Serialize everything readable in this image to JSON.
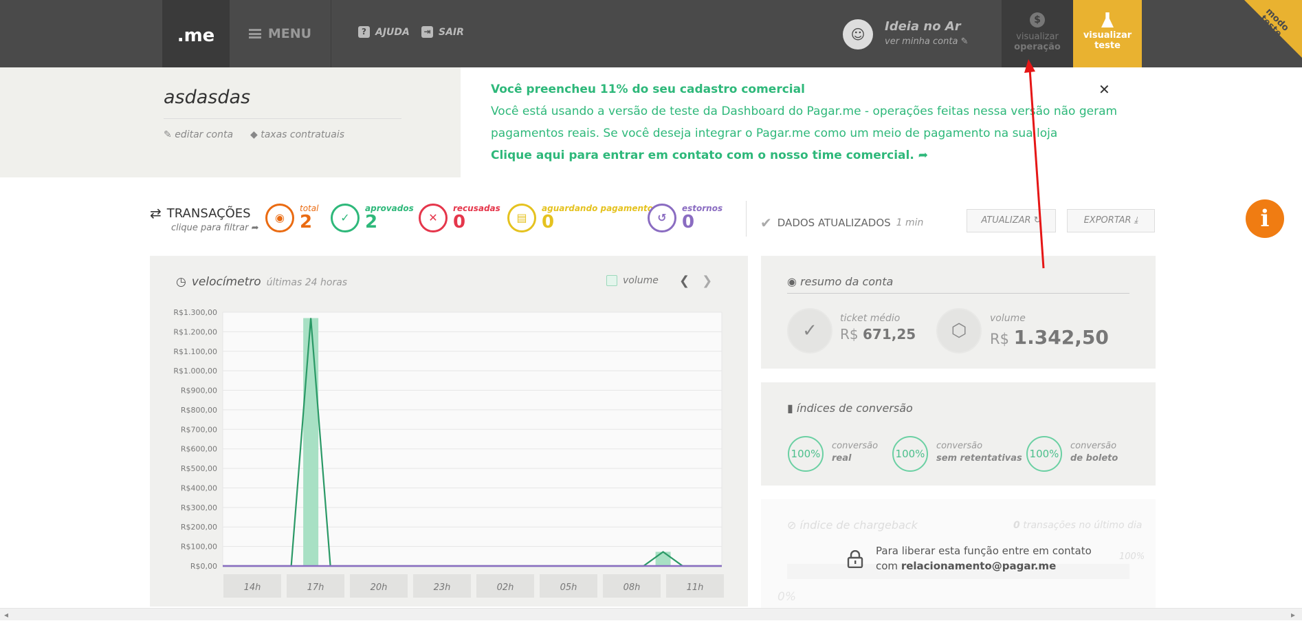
{
  "topbar": {
    "logo": ".me",
    "menu_label": "MENU",
    "help_label": "AJUDA",
    "exit_label": "SAIR",
    "user_name": "Ideia no Ar",
    "user_sub": "ver minha conta",
    "view_operation_line1": "visualizar",
    "view_operation_line2": "operação",
    "view_test_line1": "visualizar",
    "view_test_line2": "teste",
    "corner_line1": "modo",
    "corner_line2": "teste"
  },
  "account": {
    "name": "asdasdas",
    "edit_label": "editar conta",
    "fees_label": "taxas contratuais"
  },
  "notice": {
    "line1": "Você preencheu 11% do seu cadastro comercial",
    "line2": "Você está usando a versão de teste da Dashboard do Pagar.me - operações feitas nessa versão não geram",
    "line3": "pagamentos reais. Se você deseja integrar o Pagar.me como um meio de pagamento na sua loja",
    "line4": "Clique aqui para entrar em contato com o nosso time comercial."
  },
  "transactions": {
    "title": "TRANSAÇÕES",
    "sub": "clique para filtrar",
    "stats": [
      {
        "label": "total",
        "value": "2",
        "color": "#ea6b12"
      },
      {
        "label": "aprovados",
        "value": "2",
        "color": "#2eb87a"
      },
      {
        "label": "recusadas",
        "value": "0",
        "color": "#e5364b"
      },
      {
        "label": "aguardando pagamento",
        "value": "0",
        "color": "#e5c21f"
      },
      {
        "label": "estornos",
        "value": "0",
        "color": "#8a6cc1"
      }
    ],
    "updated_label": "DADOS ATUALIZADOS",
    "updated_time": "1 min",
    "refresh_label": "ATUALIZAR",
    "export_label": "EXPORTAR"
  },
  "velocimetro": {
    "title": "velocímetro",
    "subtitle": "últimas 24 horas",
    "legend_volume": "volume"
  },
  "chart_data": {
    "type": "bar",
    "ylim": [
      0,
      1300
    ],
    "y_ticks": [
      "R$0,00",
      "R$100,00",
      "R$200,00",
      "R$300,00",
      "R$400,00",
      "R$500,00",
      "R$600,00",
      "R$700,00",
      "R$800,00",
      "R$900,00",
      "R$1.000,00",
      "R$1.100,00",
      "R$1.200,00",
      "R$1.300,00"
    ],
    "x_tick_labels": [
      "14h",
      "17h",
      "20h",
      "23h",
      "02h",
      "05h",
      "08h",
      "11h"
    ],
    "hours": 24,
    "first_hour": "14h",
    "series": [
      {
        "name": "volume",
        "kind": "bar",
        "points": [
          {
            "hour": 17,
            "value": 1270
          },
          {
            "hour": 11,
            "value": 72.5
          }
        ]
      },
      {
        "kind": "line",
        "points": [
          {
            "hour": 17,
            "value": 1270
          },
          {
            "hour": 11,
            "value": 72.5
          }
        ]
      }
    ],
    "grid": true
  },
  "summary": {
    "title": "resumo da conta",
    "ticket_label": "ticket médio",
    "ticket_currency": "R$",
    "ticket_value": "671,25",
    "volume_label": "volume",
    "volume_currency": "R$",
    "volume_value": "1.342,50"
  },
  "conversion": {
    "title": "índices de conversão",
    "items": [
      {
        "value": "100%",
        "line1": "conversão",
        "line2": "real"
      },
      {
        "value": "100%",
        "line1": "conversão",
        "line2": "sem retentativas"
      },
      {
        "value": "100%",
        "line1": "conversão",
        "line2": "de boleto"
      }
    ]
  },
  "chargeback": {
    "title": "índice de chargeback",
    "right_count": "0",
    "right_text": "transações no último dia",
    "pct_right": "100%",
    "pct_left": "0%",
    "lock_line1": "Para liberar esta função entre em contato",
    "lock_line2_prefix": "com",
    "lock_email": "relacionamento@pagar.me"
  }
}
